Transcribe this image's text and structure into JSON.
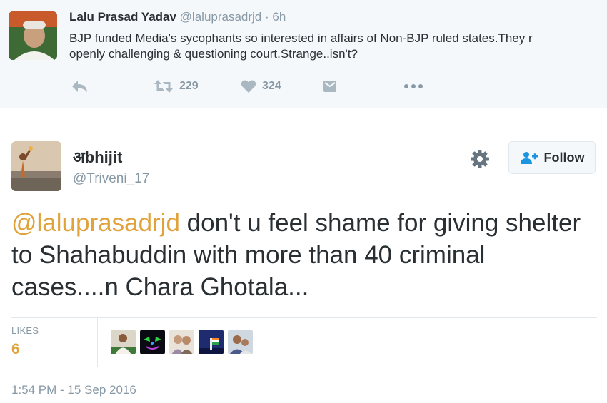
{
  "parent_tweet": {
    "name": "Lalu Prasad Yadav",
    "handle": "@laluprasadrjd",
    "dot": "·",
    "time": "6h",
    "text": "BJP funded Media's sycophants so interested in affairs of Non-BJP ruled states.They r openly challenging & questioning court.Strange..isn't?",
    "actions": {
      "reply_icon": "reply-icon",
      "retweet_icon": "retweet-icon",
      "retweet_count": "229",
      "like_icon": "heart-icon",
      "like_count": "324",
      "dm_icon": "direct-message-icon",
      "more_icon": "more-icon"
    }
  },
  "main_tweet": {
    "name": "अbhijit",
    "handle": "@Triveni_17",
    "settings_icon": "gear-icon",
    "follow_label": "Follow",
    "follow_icon": "add-person-icon",
    "mention": "@laluprasadrjd",
    "text": " don't u feel shame for giving shelter to Shahabuddin with more than 40 criminal cases....n Chara Ghotala...",
    "likes_label": "LIKES",
    "likes_count": "6",
    "timestamp": "1:54 PM - 15 Sep 2016"
  },
  "colors": {
    "accent": "#e0a23a",
    "muted": "#8899a6",
    "text": "#292f33",
    "border": "#e1e8ed",
    "parent_bg": "#f5f8fa",
    "follow_icon": "#1b95e0"
  }
}
